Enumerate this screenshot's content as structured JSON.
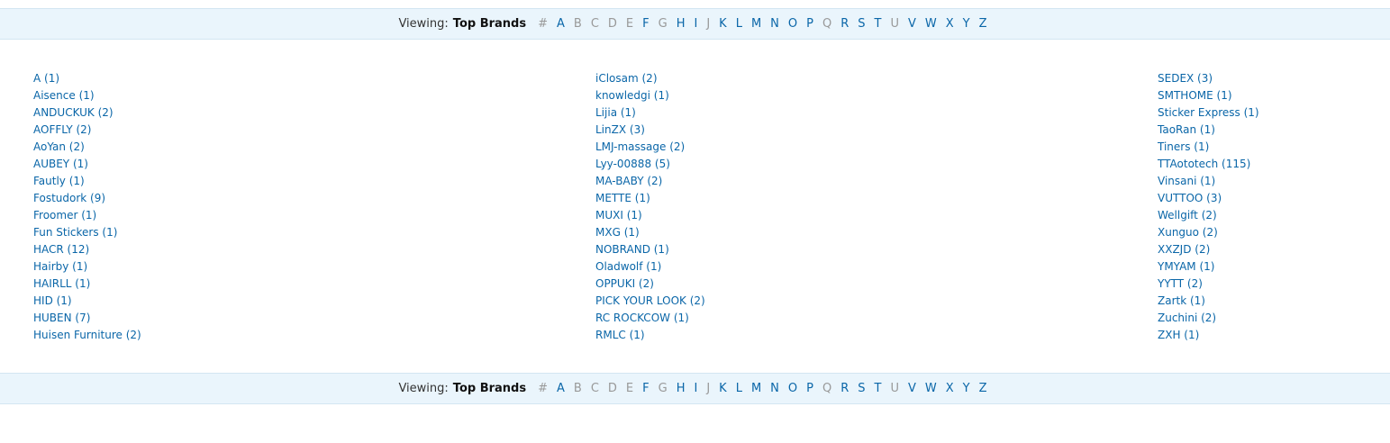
{
  "viewing": {
    "label": "Viewing:",
    "value": "Top Brands"
  },
  "letters": [
    {
      "char": "#",
      "enabled": false
    },
    {
      "char": "A",
      "enabled": true
    },
    {
      "char": "B",
      "enabled": false
    },
    {
      "char": "C",
      "enabled": false
    },
    {
      "char": "D",
      "enabled": false
    },
    {
      "char": "E",
      "enabled": false
    },
    {
      "char": "F",
      "enabled": true
    },
    {
      "char": "G",
      "enabled": false
    },
    {
      "char": "H",
      "enabled": true
    },
    {
      "char": "I",
      "enabled": true
    },
    {
      "char": "J",
      "enabled": false
    },
    {
      "char": "K",
      "enabled": true
    },
    {
      "char": "L",
      "enabled": true
    },
    {
      "char": "M",
      "enabled": true
    },
    {
      "char": "N",
      "enabled": true
    },
    {
      "char": "O",
      "enabled": true
    },
    {
      "char": "P",
      "enabled": true
    },
    {
      "char": "Q",
      "enabled": false
    },
    {
      "char": "R",
      "enabled": true
    },
    {
      "char": "S",
      "enabled": true
    },
    {
      "char": "T",
      "enabled": true
    },
    {
      "char": "U",
      "enabled": false
    },
    {
      "char": "V",
      "enabled": true
    },
    {
      "char": "W",
      "enabled": true
    },
    {
      "char": "X",
      "enabled": true
    },
    {
      "char": "Y",
      "enabled": true
    },
    {
      "char": "Z",
      "enabled": true
    }
  ],
  "brand_columns": [
    [
      "A (1)",
      "Aisence (1)",
      "ANDUCKUK (2)",
      "AOFFLY (2)",
      "AoYan (2)",
      "AUBEY (1)",
      "Fautly (1)",
      "Fostudork (9)",
      "Froomer (1)",
      "Fun Stickers (1)",
      "HACR (12)",
      "Hairby (1)",
      "HAIRLL (1)",
      "HID (1)",
      "HUBEN (7)",
      "Huisen Furniture (2)"
    ],
    [
      "iClosam (2)",
      "knowledgi (1)",
      "Lijia (1)",
      "LinZX (3)",
      "LMJ-massage (2)",
      "Lyy-00888 (5)",
      "MA-BABY (2)",
      "METTE (1)",
      "MUXI (1)",
      "MXG (1)",
      "NOBRAND (1)",
      "Oladwolf (1)",
      "OPPUKI (2)",
      "PICK YOUR LOOK (2)",
      "RC ROCKCOW (1)",
      "RMLC (1)"
    ],
    [
      "SEDEX (3)",
      "SMTHOME (1)",
      "Sticker Express (1)",
      "TaoRan (1)",
      "Tiners (1)",
      "TTAototech (115)",
      "Vinsani (1)",
      "VUTTOO (3)",
      "Wellgift (2)",
      "Xunguo (2)",
      "XXZJD (2)",
      "YMYAM (1)",
      "YYTT (2)",
      "Zartk (1)",
      "Zuchini (2)",
      "ZXH (1)"
    ]
  ],
  "colors": {
    "link": "#0a66a8",
    "disabled": "#999999",
    "bar_background": "#eaf5fc"
  }
}
